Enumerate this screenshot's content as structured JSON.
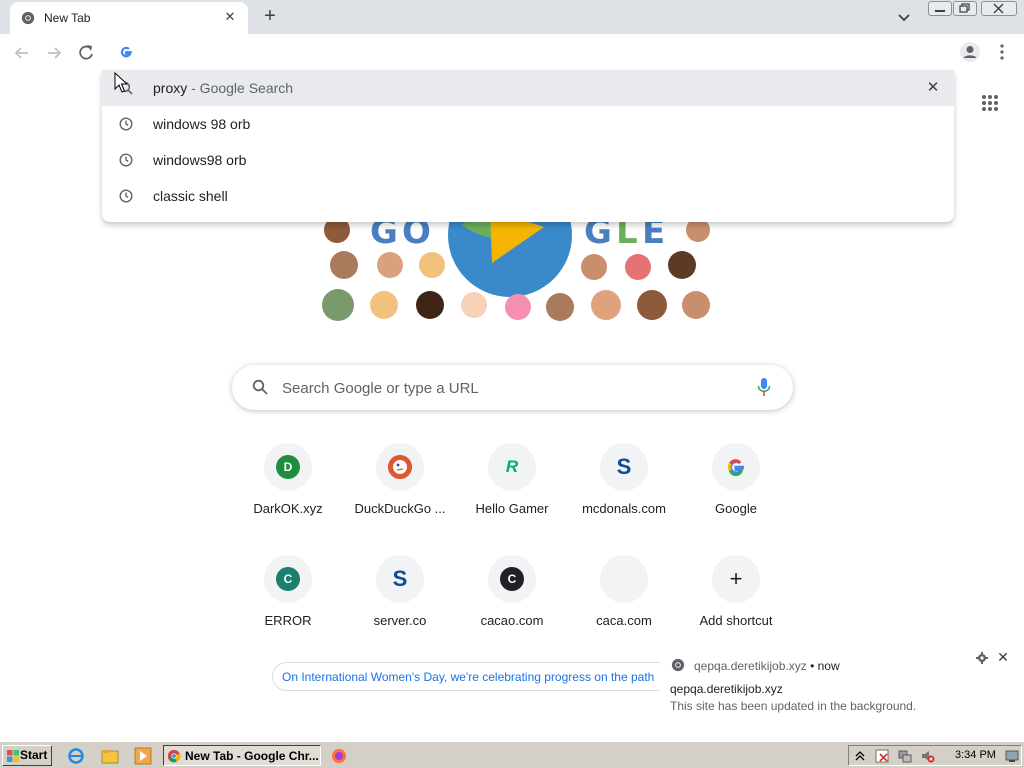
{
  "colors": {
    "chrome_frame": "#dee1e6",
    "link_blue": "#1a73e8",
    "taskbar": "#d4d0c8"
  },
  "browser": {
    "tab": {
      "title": "New Tab",
      "icon": "chrome-icon"
    },
    "window_controls": [
      "minimize",
      "restore",
      "close"
    ]
  },
  "omnibox": {
    "value": "",
    "icon": "google-g-icon",
    "suggestions": [
      {
        "query": "proxy",
        "suffix": "- Google Search",
        "icon": "search-icon"
      },
      {
        "query": "windows 98 orb",
        "icon": "history-clock-icon"
      },
      {
        "query": "windows98 orb",
        "icon": "history-clock-icon"
      },
      {
        "query": "classic shell",
        "icon": "history-clock-icon"
      }
    ]
  },
  "search": {
    "placeholder": "Search Google or type a URL"
  },
  "shortcuts": [
    {
      "label": "DarkOK.xyz",
      "icon_letter": "D",
      "badge_color": "#1e8e3e",
      "icon": "letter-d-icon"
    },
    {
      "label": "DuckDuckGo ...",
      "icon_letter": "",
      "badge_color": "#de5833",
      "icon": "duckduckgo-icon"
    },
    {
      "label": "Hello Gamer",
      "icon_letter": "R",
      "badge_color": "#00b06f",
      "icon": "roblox-icon"
    },
    {
      "label": "mcdonals.com",
      "icon_letter": "S",
      "badge_color": "#0f4c97",
      "icon": "s-logo-icon"
    },
    {
      "label": "Google",
      "icon_letter": "",
      "badge_color": "#4285f4",
      "icon": "google-g-icon"
    },
    {
      "label": "ERROR",
      "icon_letter": "C",
      "badge_color": "#1a7f6e",
      "icon": "letter-c-icon"
    },
    {
      "label": "server.co",
      "icon_letter": "S",
      "badge_color": "#0f4c97",
      "icon": "s-logo-icon"
    },
    {
      "label": "cacao.com",
      "icon_letter": "C",
      "badge_color": "#202124",
      "icon": "letter-c-icon"
    },
    {
      "label": "caca.com",
      "icon_letter": "",
      "badge_color": "#f1f3f4",
      "icon": "blank-icon"
    },
    {
      "label": "Add shortcut",
      "icon_letter": "+",
      "badge_color": "#f1f3f4",
      "icon": "plus-icon"
    }
  ],
  "promo": {
    "text": "On International Women's Day, we're celebrating progress on the path"
  },
  "notification": {
    "site": "qepqa.deretikijob.xyz",
    "separator": "•",
    "time": "now",
    "title": "qepqa.deretikijob.xyz",
    "body": "This site has been updated in the background."
  },
  "taskbar": {
    "start_label": "Start",
    "task_label": "New Tab - Google Chr...",
    "clock": "3:34 PM"
  }
}
